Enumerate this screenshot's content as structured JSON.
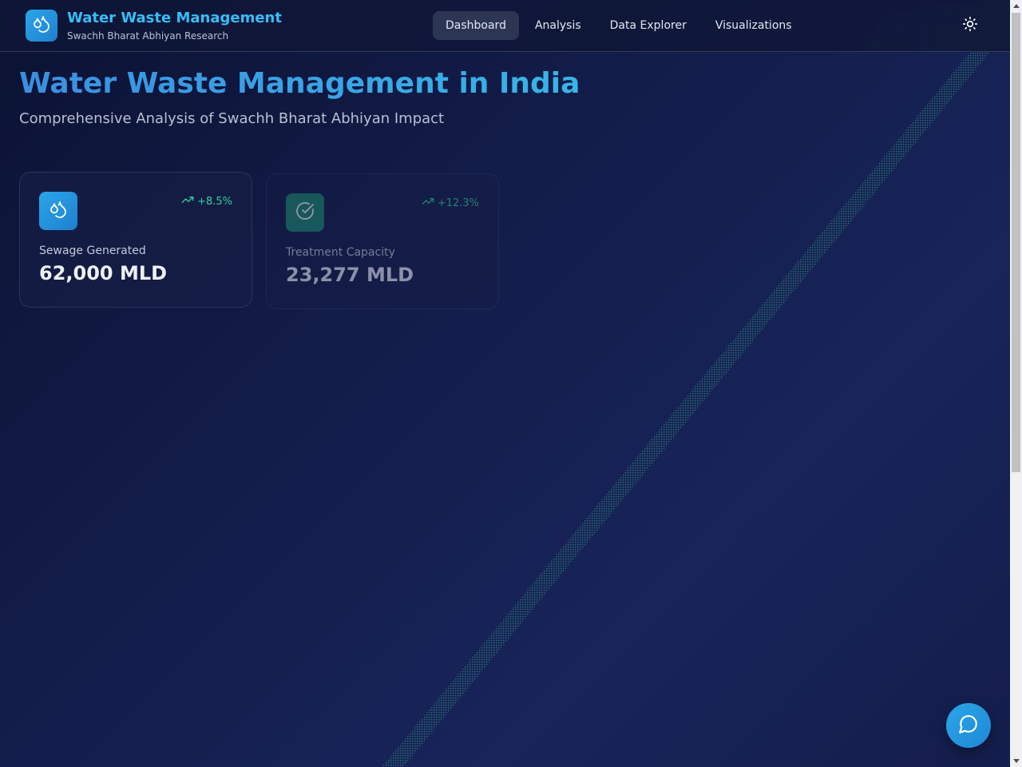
{
  "header": {
    "brand_title": "Water Waste Management",
    "brand_subtitle": "Swachh Bharat Abhiyan Research",
    "nav": [
      {
        "label": "Dashboard",
        "active": true
      },
      {
        "label": "Analysis",
        "active": false
      },
      {
        "label": "Data Explorer",
        "active": false
      },
      {
        "label": "Visualizations",
        "active": false
      }
    ],
    "logo_icon": "droplets-icon",
    "theme_icon": "sun-icon"
  },
  "main": {
    "title": "Water Waste Management in India",
    "subtitle": "Comprehensive Analysis of Swachh Bharat Abhiyan Impact",
    "stats": [
      {
        "icon": "droplets-icon",
        "trend": "+8.5%",
        "label": "Sewage Generated",
        "value": "62,000 MLD",
        "icon_color": "#2196d8"
      },
      {
        "icon": "check-circle-icon",
        "trend": "+12.3%",
        "label": "Treatment Capacity",
        "value": "23,277 MLD",
        "icon_color": "#1f8a6e"
      }
    ]
  },
  "chat": {
    "icon": "message-circle-icon"
  },
  "colors": {
    "accent": "#38bdf8",
    "trend": "#34d399",
    "background": "#131d4a"
  }
}
